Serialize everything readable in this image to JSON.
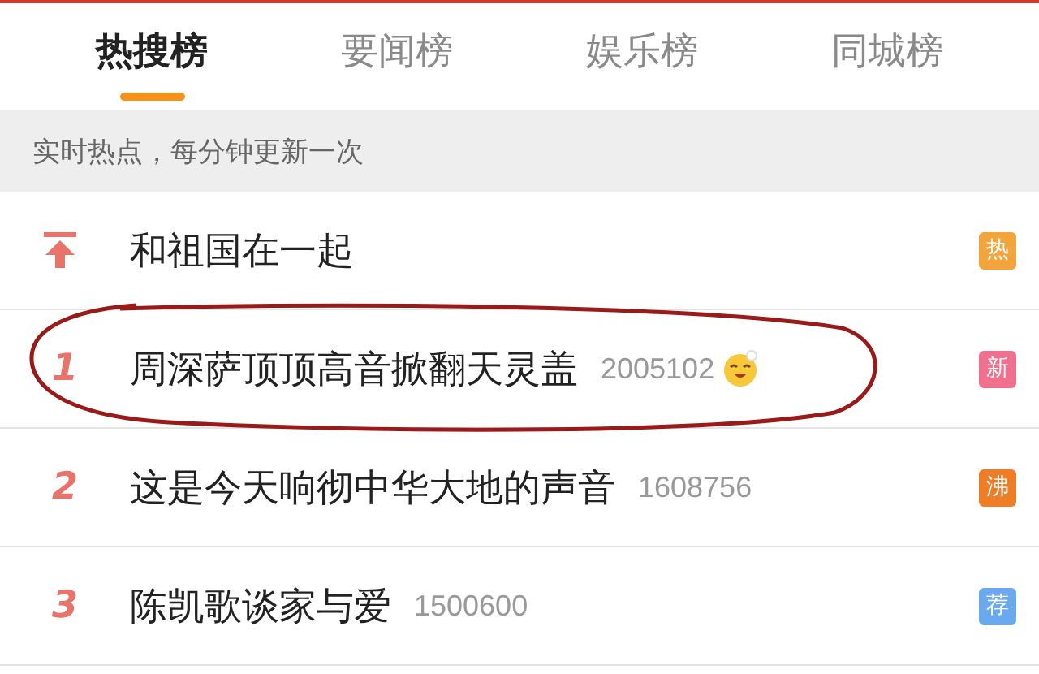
{
  "tabs": [
    {
      "label": "热搜榜",
      "selected": true
    },
    {
      "label": "要闻榜",
      "selected": false
    },
    {
      "label": "娱乐榜",
      "selected": false
    },
    {
      "label": "同城榜",
      "selected": false
    }
  ],
  "notice": "实时热点，每分钟更新一次",
  "rows": [
    {
      "kind": "pinned",
      "title": "和祖国在一起",
      "badge": "热",
      "color": "#f3a43b",
      "circled": false
    },
    {
      "kind": "ranked",
      "rank": "1",
      "title": "周深萨顶顶高音掀翻天灵盖",
      "count": "2005102",
      "emoji": true,
      "badge": "新",
      "color": "#f0708e",
      "circled": true
    },
    {
      "kind": "ranked",
      "rank": "2",
      "title": "这是今天响彻中华大地的声音",
      "count": "1608756",
      "emoji": false,
      "badge": "沸",
      "color": "#ef7d26",
      "circled": false
    },
    {
      "kind": "ranked",
      "rank": "3",
      "title": "陈凯歌谈家与爱",
      "count": "1500600",
      "emoji": false,
      "badge": "荐",
      "color": "#6aa9ee",
      "circled": false
    }
  ]
}
